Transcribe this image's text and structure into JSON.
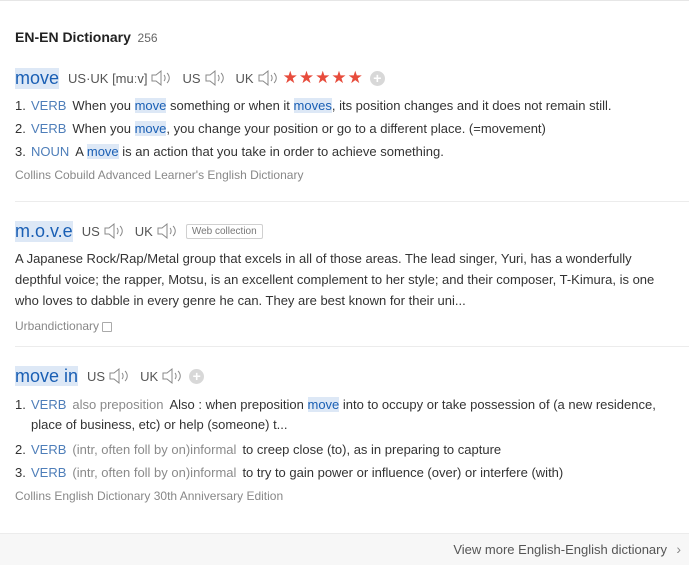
{
  "header": {
    "title": "EN-EN Dictionary",
    "count": "256"
  },
  "entry1": {
    "word": "move",
    "pron_us_uk": "US·UK [muːv]",
    "us": "US",
    "uk": "UK",
    "stars": "★★★★★",
    "defs": [
      {
        "num": "1.",
        "pos": "VERB",
        "pre": "When you ",
        "kw1": "move",
        "mid": " something or when it ",
        "kw2": "moves",
        "post": ", its position changes and it does not remain still."
      },
      {
        "num": "2.",
        "pos": "VERB",
        "pre": "When you ",
        "kw1": "move",
        "post": ", you change your position or go to a different place. (=movement)"
      },
      {
        "num": "3.",
        "pos": "NOUN",
        "pre": "A ",
        "kw1": "move",
        "post": " is an action that you take in order to achieve something."
      }
    ],
    "source": "Collins Cobuild Advanced Learner's English Dictionary"
  },
  "entry2": {
    "word": "m.o.v.e",
    "us": "US",
    "uk": "UK",
    "tag": "Web collection",
    "text": "A Japanese Rock/Rap/Metal group that excels in all of those areas. The lead singer, Yuri, has a wonderfully depthful voice; the rapper, Motsu, is an excellent complement to her style; and their composer, T-Kimura, is one who loves to dabble in every genre he can. They are best known for their uni...",
    "source": "Urbandictionary"
  },
  "entry3": {
    "word": "move in",
    "us": "US",
    "uk": "UK",
    "defs": [
      {
        "num": "1.",
        "pos": "VERB",
        "pos2": "also preposition",
        "pre": "Also : when preposition ",
        "kw1": "move",
        "post": " into to occupy or take possession of (a new residence, place of business, etc) or help (someone) t..."
      },
      {
        "num": "2.",
        "pos": "VERB",
        "pos2": "(intr, often foll by on)informal",
        "text": "to creep close (to), as in preparing to capture"
      },
      {
        "num": "3.",
        "pos": "VERB",
        "pos2": "(intr, often foll by on)informal",
        "text": "to try to gain power or influence (over) or interfere (with)"
      }
    ],
    "source": "Collins English Dictionary 30th Anniversary Edition"
  },
  "footer": {
    "more": "View more English-English dictionary",
    "chevron": "›"
  }
}
